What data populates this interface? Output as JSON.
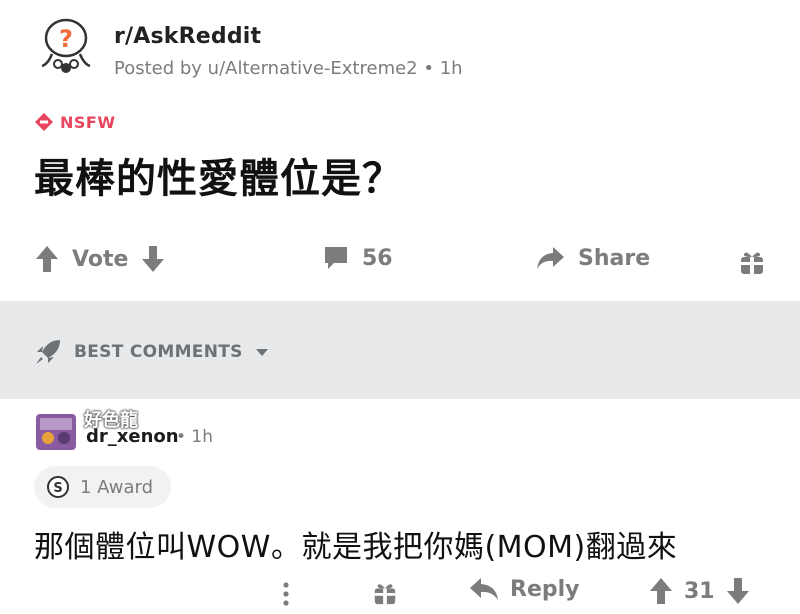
{
  "post": {
    "subreddit": "r/AskReddit",
    "posted_by": "Posted by u/Alternative-Extreme2 • 1h",
    "nsfw_label": "NSFW",
    "title": "最棒的性愛體位是？"
  },
  "actions": {
    "vote_label": "Vote",
    "comment_count": "56",
    "share_label": "Share"
  },
  "sort": {
    "label": "BEST COMMENTS"
  },
  "comment": {
    "watermark": "好色龍",
    "username": "dr_xenon",
    "time": "• 1h",
    "award_label": "1 Award",
    "body": "那個體位叫WOW。就是我把你媽(MOM)翻過來",
    "reply_label": "Reply",
    "score": "31"
  },
  "icons": {
    "subreddit_avatar": "askreddit-snoo-icon",
    "nsfw": "nsfw-diamond-icon",
    "upvote": "upvote-arrow-icon",
    "downvote": "downvote-arrow-icon",
    "comment": "comment-bubble-icon",
    "share": "share-arrow-icon",
    "award": "gift-icon",
    "sort": "rocket-icon",
    "more": "more-vertical-icon",
    "reply": "reply-arrow-icon",
    "award_coin": "silver-award-icon"
  },
  "colors": {
    "nsfw": "#e8455f",
    "muted": "#7c7c7c",
    "sort_bar": "#e7e9eb"
  }
}
